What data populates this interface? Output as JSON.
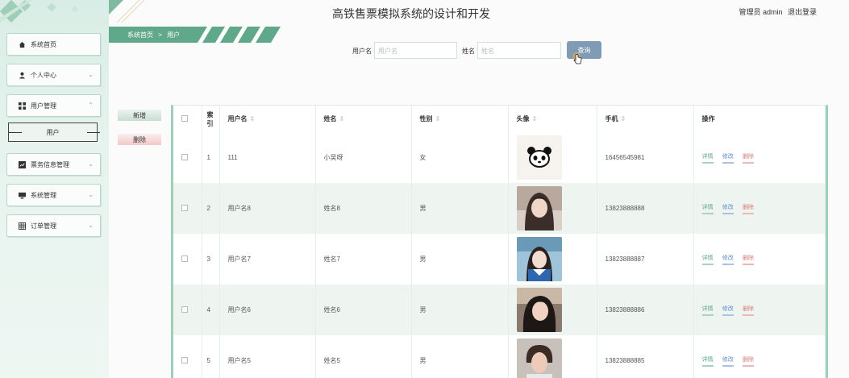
{
  "header": {
    "title": "高铁售票模拟系统的设计和开发",
    "user": "管理员 admin",
    "logout": "退出登录"
  },
  "breadcrumb": {
    "home": "系统首页",
    "sep": ">",
    "current": "用户"
  },
  "sidebar": {
    "items": [
      {
        "label": "系统首页",
        "icon": "home-icon"
      },
      {
        "label": "个人中心",
        "icon": "person-icon"
      },
      {
        "label": "用户管理",
        "icon": "grid-icon"
      },
      {
        "label": "票务信息管理",
        "icon": "chart-icon"
      },
      {
        "label": "系统管理",
        "icon": "monitor-icon"
      },
      {
        "label": "订单管理",
        "icon": "table-icon"
      }
    ],
    "sub_item": "用户"
  },
  "search": {
    "username_label": "用户名",
    "username_placeholder": "用户名",
    "name_label": "姓名",
    "name_placeholder": "姓名",
    "button": "查询"
  },
  "actions": {
    "add": "新增",
    "delete": "删除"
  },
  "table": {
    "columns": [
      "",
      "索引",
      "用户名",
      "姓名",
      "性别",
      "头像",
      "手机",
      "操作"
    ],
    "rows": [
      {
        "index": "1",
        "username": "111",
        "name": "小吴呀",
        "gender": "女",
        "phone": "16456545981",
        "avatar": "panda"
      },
      {
        "index": "2",
        "username": "用户名8",
        "name": "姓名8",
        "gender": "男",
        "phone": "13823888888",
        "avatar": "photo"
      },
      {
        "index": "3",
        "username": "用户名7",
        "name": "姓名7",
        "gender": "男",
        "phone": "13823888887",
        "avatar": "photo"
      },
      {
        "index": "4",
        "username": "用户名6",
        "name": "姓名6",
        "gender": "男",
        "phone": "13823888886",
        "avatar": "photo"
      },
      {
        "index": "5",
        "username": "用户名5",
        "name": "姓名5",
        "gender": "男",
        "phone": "13823888885",
        "avatar": "photo"
      }
    ],
    "ops": {
      "detail": "详情",
      "edit": "修改",
      "delete": "删除"
    }
  }
}
